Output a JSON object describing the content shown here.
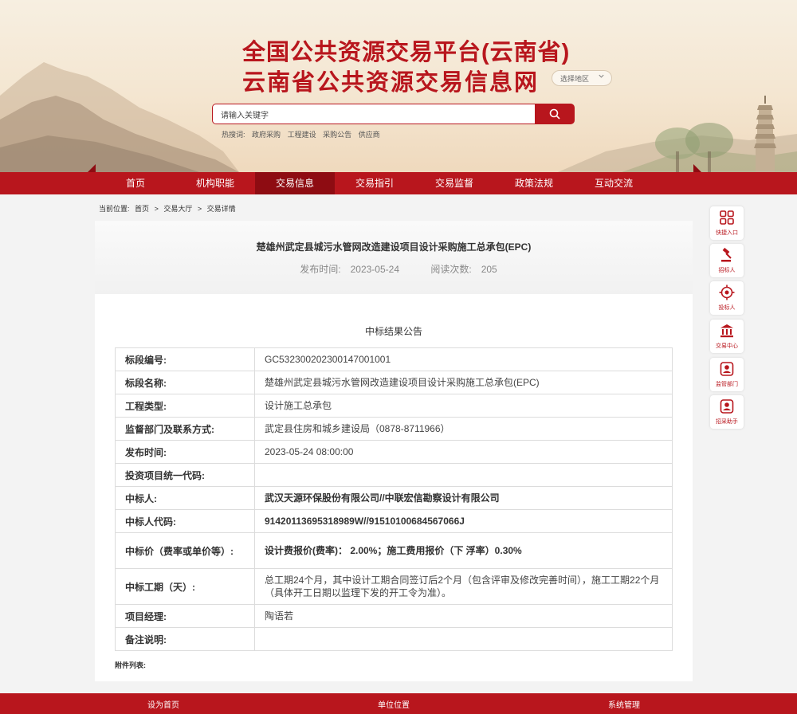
{
  "header": {
    "title_line1": "全国公共资源交易平台(云南省)",
    "title_line2": "云南省公共资源交易信息网",
    "region_select": "选择地区",
    "search_placeholder": "请输入关键字",
    "hot_label": "热搜词:",
    "hot_words": [
      "政府采购",
      "工程建设",
      "采购公告",
      "供应商"
    ]
  },
  "nav": {
    "items": [
      {
        "label": "首页"
      },
      {
        "label": "机构职能"
      },
      {
        "label": "交易信息"
      },
      {
        "label": "交易指引"
      },
      {
        "label": "交易监督"
      },
      {
        "label": "政策法规"
      },
      {
        "label": "互动交流"
      }
    ],
    "active_index": 2
  },
  "breadcrumb": {
    "prefix": "当前位置:",
    "items": [
      "首页",
      "交易大厅",
      "交易详情"
    ],
    "separator": ">"
  },
  "document": {
    "title": "楚雄州武定县城污水管网改造建设项目设计采购施工总承包(EPC)",
    "publish_label": "发布时间:",
    "publish_date": "2023-05-24",
    "views_label": "阅读次数:",
    "views": "205",
    "section_title": "中标结果公告",
    "rows": [
      {
        "key": "标段编号:",
        "value": "GC5323002023001470010​01"
      },
      {
        "key": "标段名称:",
        "value": "楚雄州武定县城污水管网改造建设项目设计采购施工总承包(EPC)"
      },
      {
        "key": "工程类型:",
        "value": "设计施工总承包"
      },
      {
        "key": "监督部门及联系方式:",
        "value": "武定县住房和城乡建设局（0878-8711966）"
      },
      {
        "key": "发布时间:",
        "value": "2023-05-24 08:00:00"
      },
      {
        "key": "投资项目统一代码:",
        "value": ""
      },
      {
        "key": "中标人:",
        "value": "武汉天源环保股份有限公司//中联宏信勘察设计有限公司"
      },
      {
        "key": "中标人代码:",
        "value": "91420113695318989W//91510100684567066J"
      },
      {
        "key": "中标价（费率或单价等）:",
        "value": "设计费报价(费率)： 2.00%；施工费用报价（下 浮率）0.30%"
      },
      {
        "key": "中标工期（天）:",
        "value": "总工期24个月，其中设计工期合同签订后2个月（包含评审及修改完善时间），施工工期22个月（具体开工日期以监理下发的开工令为准）。"
      },
      {
        "key": "项目经理:",
        "value": "陶语若"
      },
      {
        "key": "备注说明:",
        "value": ""
      }
    ],
    "attachments_label": "附件列表:"
  },
  "side_tools": [
    {
      "label": "快捷入口",
      "icon": "grid-icon"
    },
    {
      "label": "招标人",
      "icon": "gavel-icon"
    },
    {
      "label": "投标人",
      "icon": "target-icon"
    },
    {
      "label": "交易中心",
      "icon": "bank-icon"
    },
    {
      "label": "监管部门",
      "icon": "user-badge-icon"
    },
    {
      "label": "招采助手",
      "icon": "assistant-icon"
    }
  ],
  "footer": {
    "items": [
      "设为首页",
      "单位位置",
      "系统管理"
    ]
  },
  "colors": {
    "brand_red": "#b8161d",
    "nav_active": "#8e0c12",
    "banner_bg": "#f4e6d1"
  }
}
